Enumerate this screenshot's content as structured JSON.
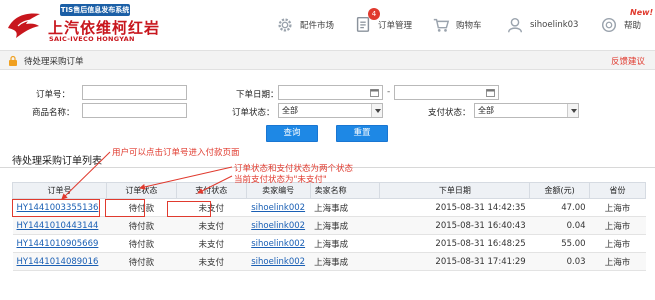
{
  "header": {
    "system_badge": "TIS售后信息发布系统",
    "brand_cn": "上汽依维柯红岩",
    "brand_en": "SAIC-IVECO HONGYAN",
    "nav": {
      "parts_market": "配件市场",
      "order_manage": "订单管理",
      "order_badge": "4",
      "cart": "购物车",
      "user": "sihoelink03",
      "help": "帮助",
      "new_tag": "New!"
    }
  },
  "title_bar": {
    "title": "待处理采购订单",
    "feedback": "反馈建议"
  },
  "search": {
    "order_no_label": "订单号：",
    "date_label": "下单日期：",
    "date_dash": "-",
    "product_label": "商品名称：",
    "order_status_label": "订单状态：",
    "order_status_value": "全部",
    "pay_status_label": "支付状态：",
    "pay_status_value": "全部",
    "query_button": "查询",
    "reset_button": "重置"
  },
  "list": {
    "title": "待处理采购订单列表",
    "columns": [
      "订单号",
      "订单状态",
      "支付状态",
      "卖家编号",
      "卖家名称",
      "下单日期",
      "金额(元)",
      "省份"
    ],
    "rows": [
      {
        "order_no": "HY1441003355136",
        "order_status": "待付款",
        "pay_status": "未支付",
        "seller_no": "sihoelink002",
        "seller_name": "上海事成",
        "date": "2015-08-31 14:42:35",
        "amount": "47.00",
        "province": "上海市"
      },
      {
        "order_no": "HY1441010443144",
        "order_status": "待付款",
        "pay_status": "未支付",
        "seller_no": "sihoelink002",
        "seller_name": "上海事成",
        "date": "2015-08-31 16:40:43",
        "amount": "0.04",
        "province": "上海市"
      },
      {
        "order_no": "HY1441010905669",
        "order_status": "待付款",
        "pay_status": "未支付",
        "seller_no": "sihoelink002",
        "seller_name": "上海事成",
        "date": "2015-08-31 16:48:25",
        "amount": "55.00",
        "province": "上海市"
      },
      {
        "order_no": "HY1441014089016",
        "order_status": "待付款",
        "pay_status": "未支付",
        "seller_no": "sihoelink002",
        "seller_name": "上海事成",
        "date": "2015-08-31 17:41:29",
        "amount": "0.03",
        "province": "上海市"
      }
    ]
  },
  "annotations": {
    "order_link_note": "用户可以点击订单号进入付款页面",
    "status_note_1": "订单状态和支付状态为两个状态",
    "status_note_2": "当前支付状态为\"未支付\""
  },
  "colors": {
    "brand_red": "#c8161d",
    "primary_button": "#1e88e5",
    "link_blue": "#1a5fb4",
    "annotation_red": "#e03a2e"
  }
}
